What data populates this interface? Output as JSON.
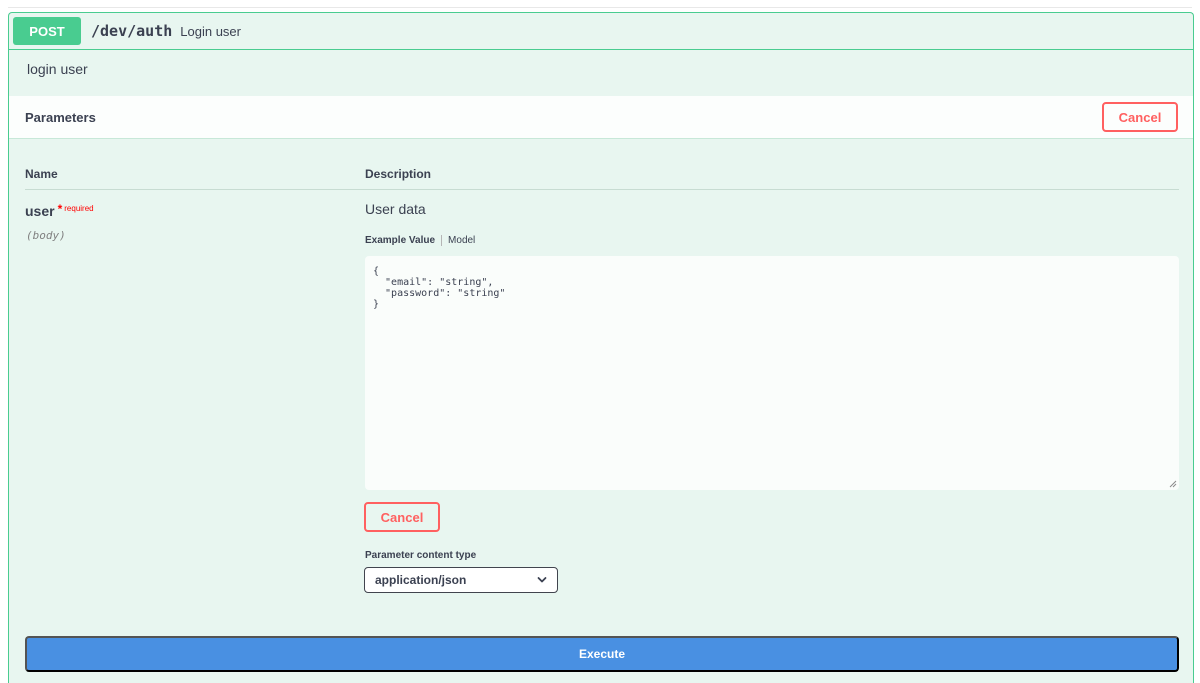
{
  "operation": {
    "method": "POST",
    "path": "/dev/auth",
    "summary": "Login user",
    "description": "login user"
  },
  "parameters_section": {
    "title": "Parameters",
    "cancel_label": "Cancel"
  },
  "columns": {
    "name": "Name",
    "description": "Description"
  },
  "param": {
    "name": "user",
    "required_star": "*",
    "required_label": "required",
    "in": "(body)",
    "description": "User data",
    "example_tab": "Example Value",
    "model_tab": "Model",
    "body_value": "{\n  \"email\": \"string\",\n  \"password\": \"string\"\n}",
    "cancel_label": "Cancel"
  },
  "content_type": {
    "label": "Parameter content type",
    "selected": "application/json"
  },
  "execute_label": "Execute",
  "colors": {
    "post": "#49cc90",
    "post_bg": "#e8f6f0",
    "cancel": "#ff6060",
    "execute": "#4990e2"
  }
}
